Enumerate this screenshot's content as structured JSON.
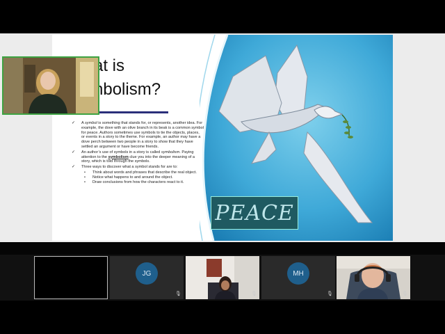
{
  "slide": {
    "title_line1": "at is",
    "title_line2": "nbolism?",
    "bullets": [
      {
        "pre": "A ",
        "em": "symbol",
        "post": " is something that stands for, or represents, another idea. For example, the dove with an olive branch in its beak is a common symbol for peace. Authors sometimes use symbols to tie the objects, places, or events in a story to the theme. For example, an author may have a dove perch between two people in a story to show that they have settled an argument or have become friends."
      },
      {
        "pre": "An author’s use of symbols in a story is called ",
        "em": "symbolism",
        "post": ". Paying attention to the ",
        "link": "symbolism",
        "post2": " clue you into the deeper meaning of a story, which is told through the symbols."
      },
      {
        "pre": "Three ways to discover what a symbol stands for are to:",
        "em": "",
        "post": ""
      }
    ],
    "subbullets": [
      "Think about words and phrases that describe the real object.",
      "Notice what happens to and around the object.",
      "Draw conclusions from how the characters react to it."
    ],
    "check_glyph": "✓",
    "dot_glyph": "•",
    "peace_text": "PEACE"
  },
  "participants": [
    {
      "initials": "",
      "type": "self"
    },
    {
      "initials": "JG",
      "type": "avatar"
    },
    {
      "initials": "",
      "type": "video-girl"
    },
    {
      "initials": "MH",
      "type": "avatar"
    },
    {
      "initials": "",
      "type": "video-boy"
    }
  ],
  "icons": {
    "mute": "muted-mic-icon"
  },
  "colors": {
    "presenter_border": "#3da342",
    "avatar_bg": "#1f5f8c",
    "peace_box": "#1f5a61"
  }
}
